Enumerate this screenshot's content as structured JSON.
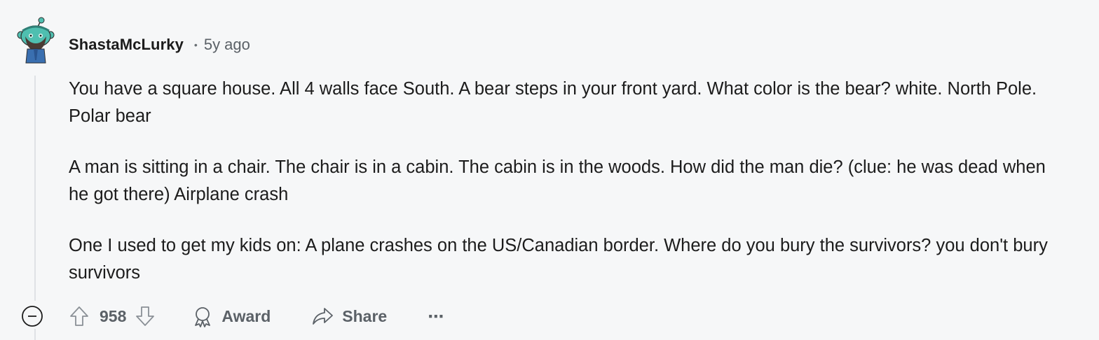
{
  "comment": {
    "username": "ShastaMcLurky",
    "separator": "•",
    "time": "5y ago",
    "paragraphs": [
      "You have a square house. All 4 walls face South. A bear steps in your front yard. What color is the bear? white. North Pole. Polar bear",
      "A man is sitting in a chair. The chair is in a cabin. The cabin is in the woods. How did the man die? (clue: he was dead when he got there) Airplane crash",
      "One I used to get my kids on: A plane crashes on the US/Canadian border. Where do you bury the survivors? you don't bury survivors"
    ]
  },
  "actions": {
    "vote_count": "958",
    "award_label": "Award",
    "share_label": "Share",
    "more_label": "⋯"
  },
  "icons": {
    "collapse": "minus-circle-icon",
    "upvote": "arrow-up-icon",
    "downvote": "arrow-down-icon",
    "award": "award-icon",
    "share": "share-icon",
    "more": "more-horizontal-icon"
  },
  "colors": {
    "background": "#f6f7f8",
    "text_primary": "#1c1c1c",
    "text_secondary": "#5b6167",
    "thread_line": "#dfe2e5",
    "avatar_teal": "#4fbfb0",
    "avatar_blue": "#3a6fb0"
  }
}
